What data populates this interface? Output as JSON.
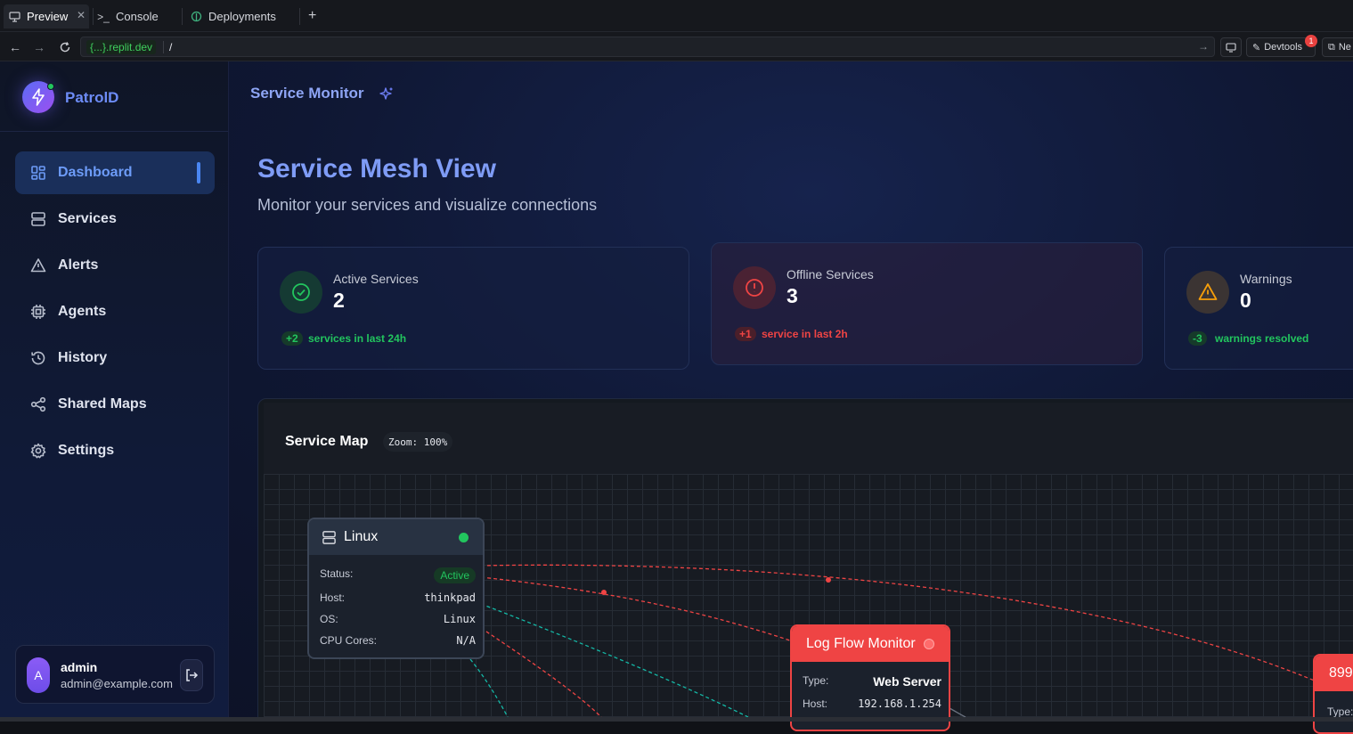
{
  "browser": {
    "tabs": [
      {
        "label": "Preview",
        "icon": "monitor-icon"
      },
      {
        "label": "Console",
        "icon": "terminal-icon"
      },
      {
        "label": "Deployments",
        "icon": "deploy-icon"
      }
    ],
    "url_host": "{...}.replit.dev",
    "url_path": "/",
    "devtools_label": "Devtools",
    "devtools_badge": "1",
    "new_window_label": "Ne"
  },
  "sidebar": {
    "brand": "PatrolD",
    "items": [
      {
        "label": "Dashboard",
        "icon": "dashboard-icon",
        "active": true
      },
      {
        "label": "Services",
        "icon": "server-icon"
      },
      {
        "label": "Alerts",
        "icon": "alert-icon"
      },
      {
        "label": "Agents",
        "icon": "cpu-icon"
      },
      {
        "label": "History",
        "icon": "history-icon"
      },
      {
        "label": "Shared Maps",
        "icon": "share-icon"
      },
      {
        "label": "Settings",
        "icon": "gear-icon"
      }
    ],
    "user": {
      "initial": "A",
      "name": "admin",
      "email": "admin@example.com"
    }
  },
  "header": {
    "title": "Service Monitor"
  },
  "main": {
    "title": "Service Mesh View",
    "subtitle": "Monitor your services and visualize connections",
    "stats": [
      {
        "label": "Active Services",
        "value": "2",
        "delta": "+2",
        "note": "services in last 24h",
        "tone": "green"
      },
      {
        "label": "Offline Services",
        "value": "3",
        "delta": "+1",
        "note": "service in last 2h",
        "tone": "red"
      },
      {
        "label": "Warnings",
        "value": "0",
        "delta": "-3",
        "note": "warnings resolved",
        "tone": "green"
      }
    ]
  },
  "map": {
    "title": "Service Map",
    "zoom": "Zoom: 100%",
    "nodes": {
      "linux": {
        "name": "Linux",
        "status_label": "Status:",
        "status": "Active",
        "host_label": "Host:",
        "host": "thinkpad",
        "os_label": "OS:",
        "os": "Linux",
        "cpu_label": "CPU Cores:",
        "cpu": "N/A"
      },
      "log": {
        "name": "Log Flow Monitor",
        "type_label": "Type:",
        "type": "Web Server",
        "host_label": "Host:",
        "host": "192.168.1.254"
      },
      "partial": {
        "name": "899",
        "type_label": "Type:"
      }
    }
  },
  "colors": {
    "accent": "#6d8cf7",
    "active": "#22c55e",
    "offline": "#ef4444",
    "warning": "#f59e0b"
  }
}
